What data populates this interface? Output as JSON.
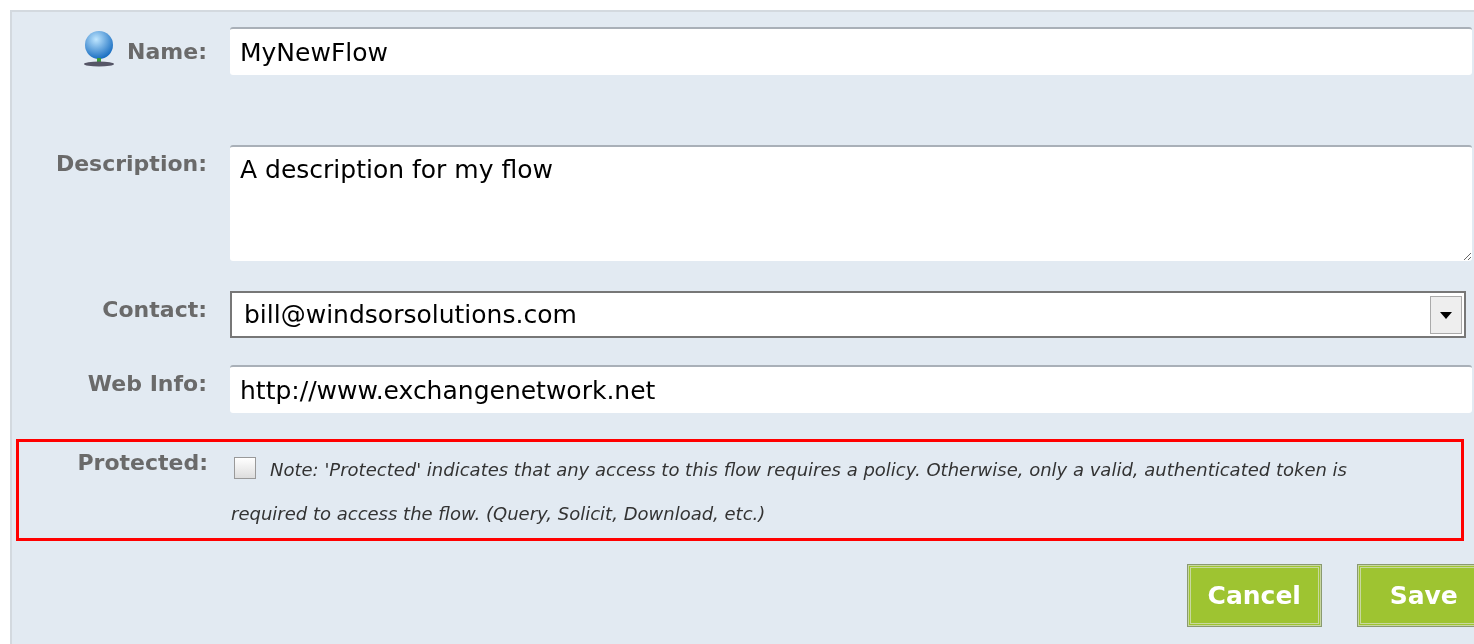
{
  "fields": [
    {
      "kind": "input",
      "label": "Name:",
      "value": "MyNewFlow"
    },
    {
      "kind": "textarea",
      "label": "Description:",
      "value": "A description for my flow"
    },
    {
      "kind": "select",
      "label": "Contact:",
      "value": "bill@windsorsolutions.com"
    },
    {
      "kind": "input",
      "label": "Web Info:",
      "value": "http://www.exchangenetwork.net"
    }
  ],
  "protected": {
    "label": "Protected:",
    "checked": false,
    "note": "Note: 'Protected' indicates that any access to this flow requires a policy. Otherwise, only a valid, authenticated token is required to access the flow. (Query, Solicit, Download, etc.)"
  },
  "buttons": [
    "Cancel",
    "Save"
  ]
}
